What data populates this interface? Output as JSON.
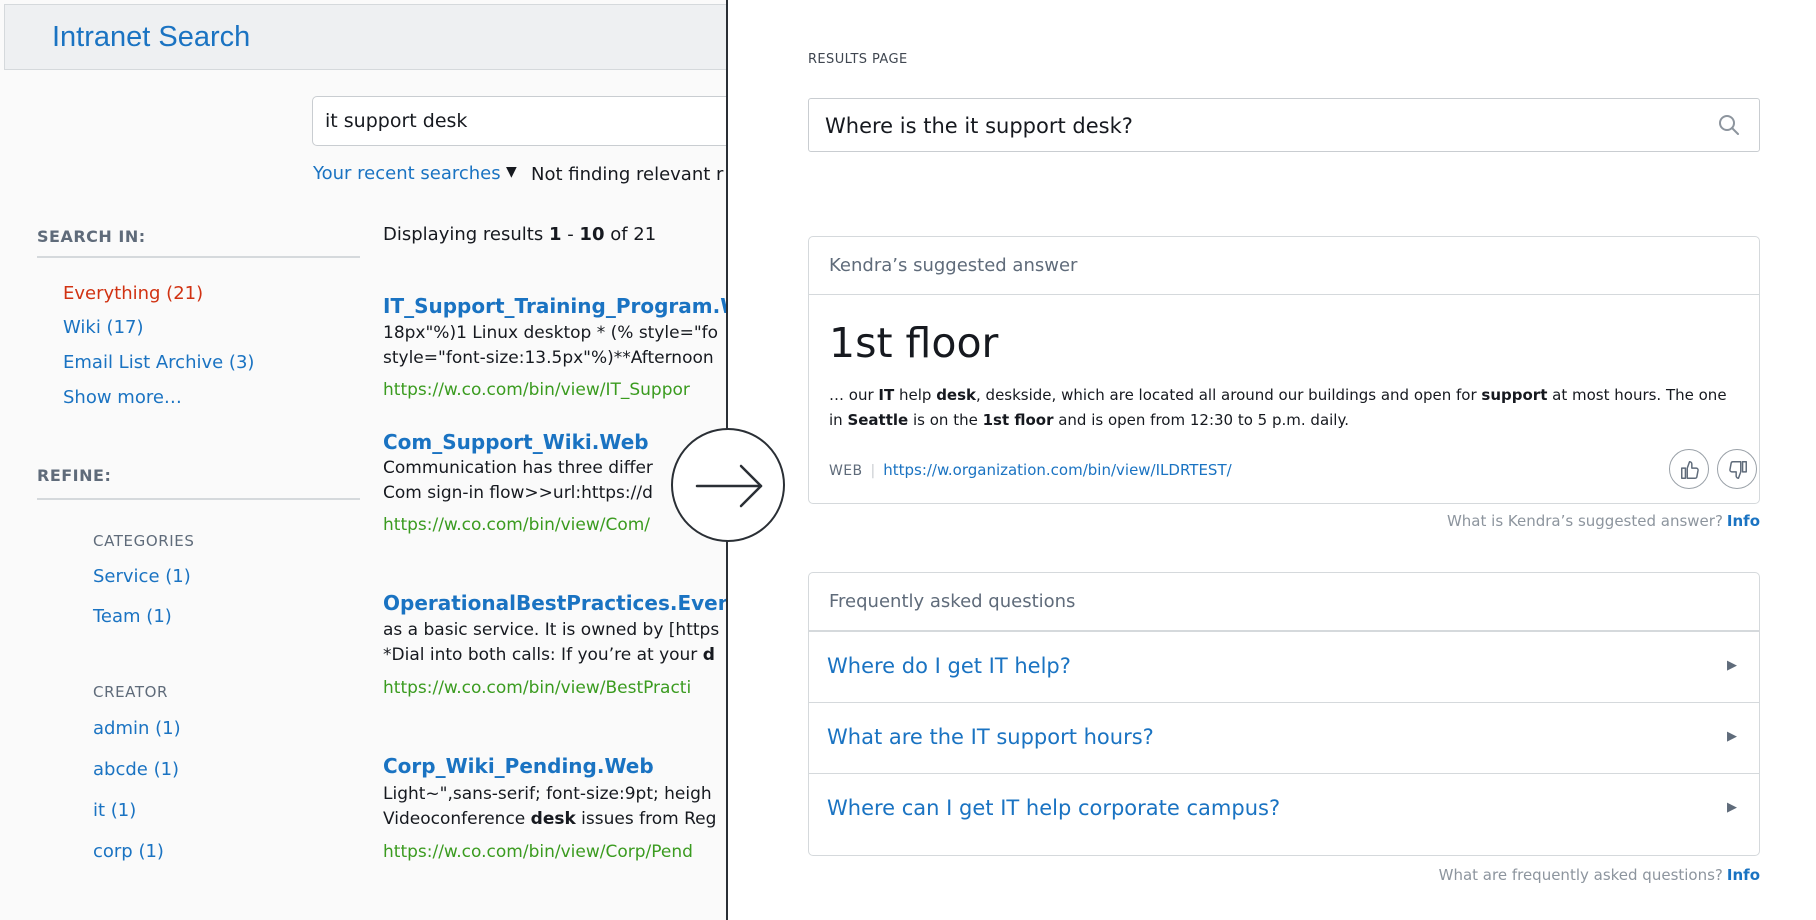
{
  "left": {
    "app_title": "Intranet Search",
    "search_value": "it support desk",
    "recent_searches": "Your recent searches",
    "not_finding": "Not finding relevant r",
    "search_in": {
      "heading": "SEARCH IN:",
      "items": [
        "Everything (21)",
        "Wiki (17)",
        "Email List Archive (3)",
        "Show more…"
      ]
    },
    "refine": {
      "heading": "REFINE:",
      "categories_heading": "CATEGORIES",
      "categories": [
        "Service (1)",
        "Team (1)"
      ],
      "creator_heading": "CREATOR",
      "creators": [
        "admin (1)",
        "abcde (1)",
        "it (1)",
        "corp (1)"
      ]
    },
    "display": {
      "prefix": "Displaying results ",
      "from": "1",
      "dash": " - ",
      "to": "10",
      "suffix": " of 21"
    },
    "results": [
      {
        "title": "IT_Support_Training_Program.W",
        "snippet1": "18px\"%)1 Linux desktop * (% style=\"fo",
        "snippet2": "style=\"font-size:13.5px\"%)**Afternoon",
        "url": "https://w.co.com/bin/view/IT_Suppor"
      },
      {
        "title": "Com_Support_Wiki.Web",
        "snippet1": "Communication has three differ",
        "snippet2": "Com sign-in flow>>url:https://d",
        "url": "https://w.co.com/bin/view/Com/"
      },
      {
        "title": "OperationalBestPractices.EventM",
        "snippet1": "as a basic service. It is owned by [https",
        "snippet2_pre": "*Dial into both calls: If you’re at your ",
        "snippet2_bold": "d",
        "url": "https://w.co.com/bin/view/BestPracti"
      },
      {
        "title": "Corp_Wiki_Pending.Web",
        "snippet1": "Light~\",sans-serif; font-size:9pt; heigh",
        "snippet2_pre": "Videoconference ",
        "snippet2_bold": "desk",
        "snippet2_post": " issues from Reg",
        "url": "https://w.co.com/bin/view/Corp/Pend"
      }
    ]
  },
  "right": {
    "results_label": "RESULTS PAGE",
    "query": "Where is the it support desk?",
    "answer": {
      "heading": "Kendra’s suggested answer",
      "big": "1st floor",
      "text": [
        {
          "t": "… our "
        },
        {
          "b": "IT"
        },
        {
          "t": " help "
        },
        {
          "b": "desk"
        },
        {
          "t": ", deskside, which are located all around our buildings and open for "
        },
        {
          "b": "support"
        },
        {
          "t": " at most hours. The one in "
        },
        {
          "b": "Seattle"
        },
        {
          "t": " is on the "
        },
        {
          "b": "1st floor"
        },
        {
          "t": " and is open from 12:30 to 5 p.m. daily."
        }
      ],
      "source_label": "WEB",
      "source_sep": "|",
      "source_url": "https://w.organization.com/bin/view/ILDRTEST/"
    },
    "answer_info": {
      "question": "What is Kendra’s suggested answer?",
      "link": "Info"
    },
    "faq": {
      "heading": "Frequently asked questions",
      "items": [
        "Where do I get IT help?",
        "What are the IT support hours?",
        "Where can I get IT help corporate campus?"
      ]
    },
    "faq_info": {
      "question": "What are frequently asked questions?",
      "link": "Info"
    }
  },
  "icons": {
    "search": "search-icon",
    "caret": "caret-down-icon",
    "arrow": "arrow-right-icon",
    "thumb_up": "thumbs-up-icon",
    "thumb_down": "thumbs-down-icon",
    "faq_expand": "triangle-right-icon"
  },
  "colors": {
    "link": "#1a73c2",
    "active_facet": "#d13212",
    "url_green": "#3a9b1f"
  }
}
